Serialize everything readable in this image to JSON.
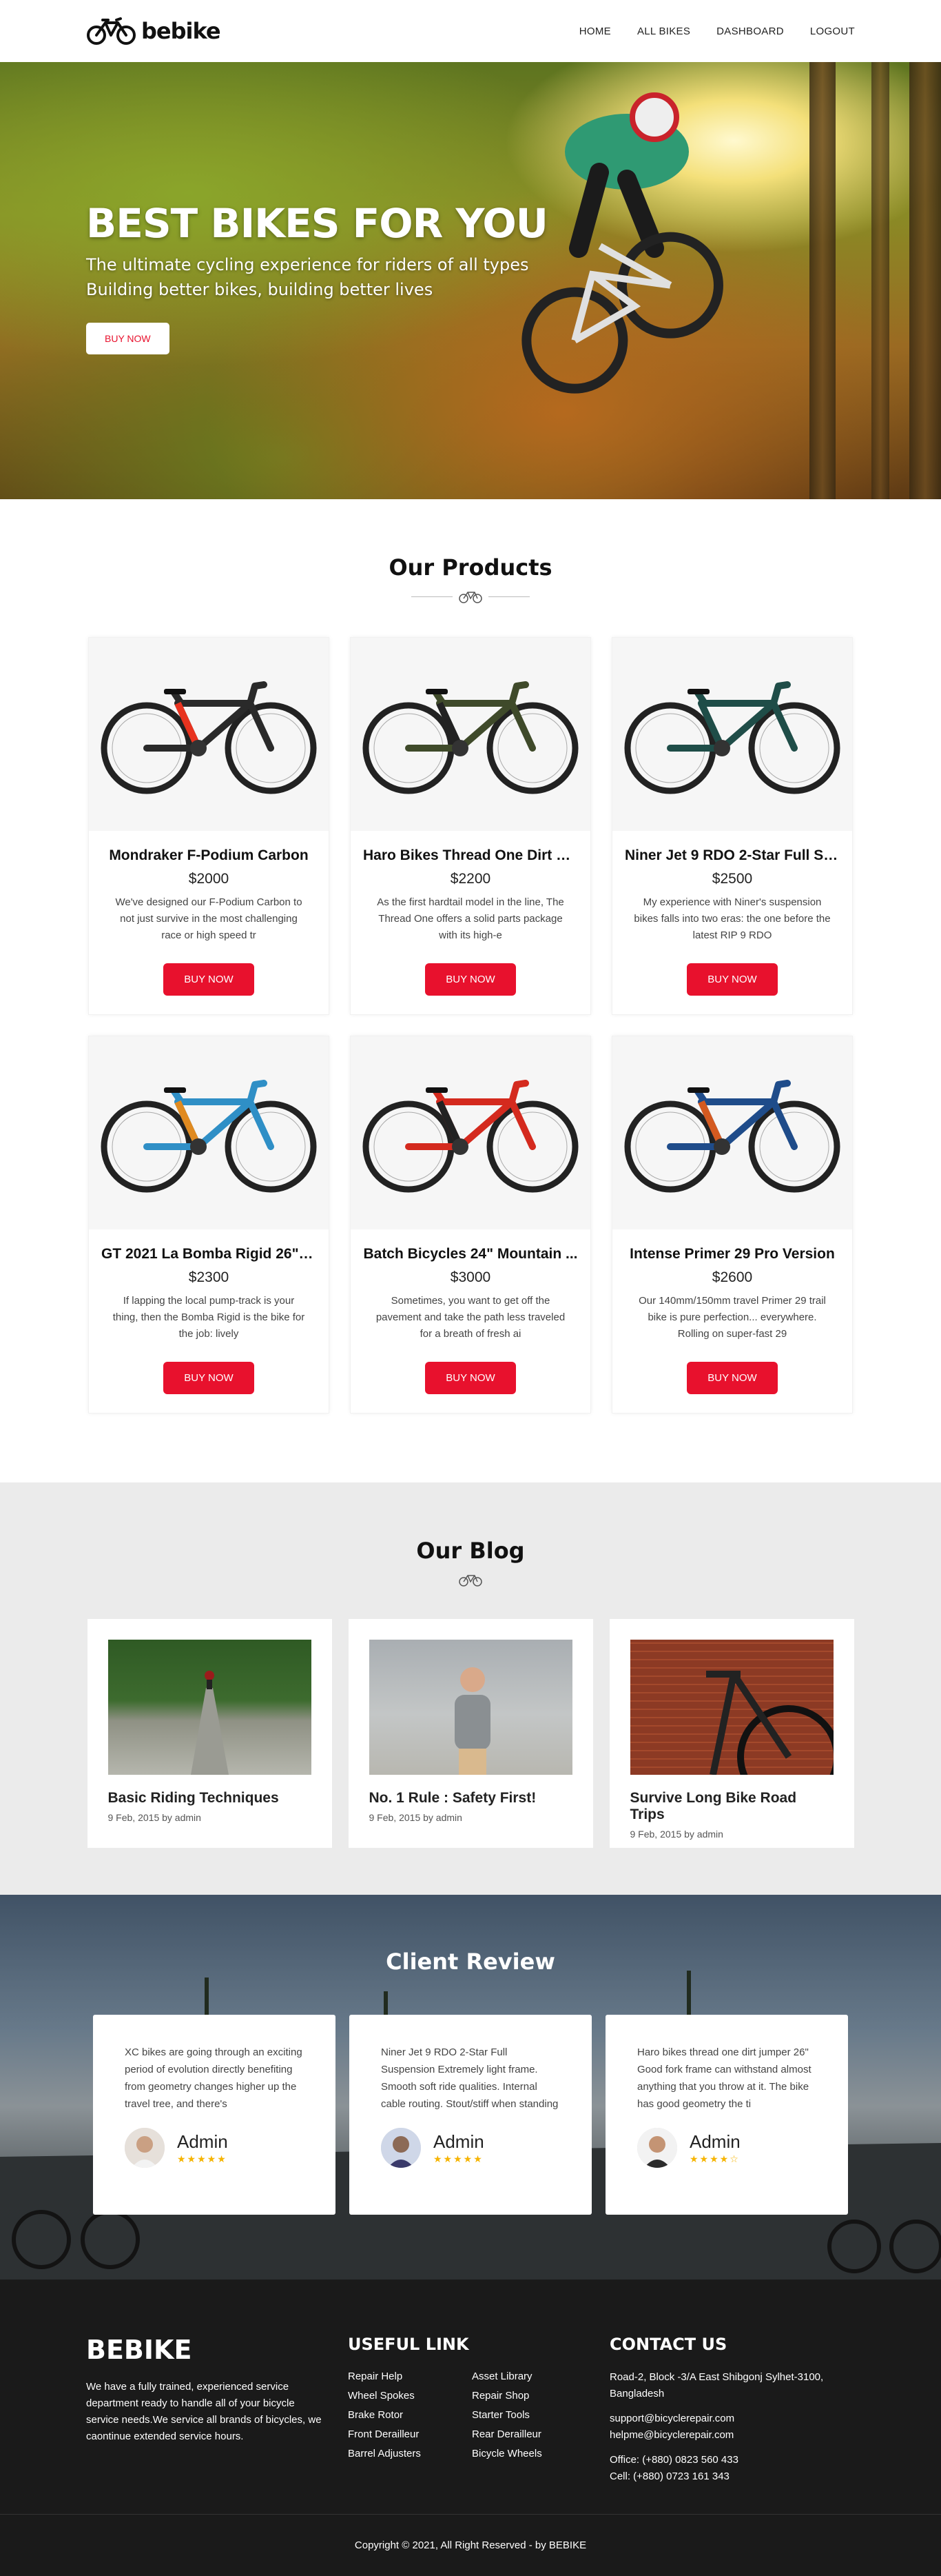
{
  "brand": {
    "name": "bebike"
  },
  "nav": {
    "links": [
      "HOME",
      "ALL BIKES",
      "DASHBOARD",
      "LOGOUT"
    ]
  },
  "hero": {
    "title": "BEST BIKES FOR YOU",
    "subtitle_1": "The ultimate cycling experience for riders of all types",
    "subtitle_2": "Building better bikes, building better lives",
    "button": "BUY NOW"
  },
  "products": {
    "title": "Our Products",
    "items": [
      {
        "name": "Mondraker F-Podium Carbon",
        "price": "$2000",
        "desc": "We've designed our F-Podium Carbon to not just survive in the most challenging race or high speed tr",
        "button": "BUY NOW",
        "frame_color": "#2a2a2a",
        "accent": "#e8331f"
      },
      {
        "name": "Haro Bikes Thread One Dirt Ju...",
        "price": "$2200",
        "desc": "As the first hardtail model in the line, The Thread One offers a solid parts package with its high-e",
        "button": "BUY NOW",
        "frame_color": "#3f4a2a",
        "accent": "#222"
      },
      {
        "name": "Niner Jet 9 RDO 2-Star Full Su...",
        "price": "$2500",
        "desc": "My experience with Niner's suspension bikes falls into two eras: the one before the latest RIP 9 RDO",
        "button": "BUY NOW",
        "frame_color": "#1f4d48",
        "accent": "#1f4d48"
      },
      {
        "name": "GT 2021 La Bomba Rigid 26\" D...",
        "price": "$2300",
        "desc": "If lapping the local pump-track is your thing, then the Bomba Rigid is the bike for the job: lively",
        "button": "BUY NOW",
        "frame_color": "#2f8fc6",
        "accent": "#e08a20"
      },
      {
        "name": "Batch Bicycles 24\" Mountain ...",
        "price": "$3000",
        "desc": "Sometimes, you want to get off the pavement and take the path less traveled for a breath of fresh ai",
        "button": "BUY NOW",
        "frame_color": "#d42a1e",
        "accent": "#222"
      },
      {
        "name": "Intense Primer 29 Pro Version",
        "price": "$2600",
        "desc": "Our 140mm/150mm travel Primer 29 trail bike is pure perfection... everywhere. Rolling on super-fast 29",
        "button": "BUY NOW",
        "frame_color": "#1f4c8a",
        "accent": "#d45a20"
      }
    ]
  },
  "blog": {
    "title": "Our Blog",
    "posts": [
      {
        "title": "Basic Riding Techniques",
        "meta": "9 Feb, 2015 by admin"
      },
      {
        "title": "No. 1 Rule : Safety First!",
        "meta": "9 Feb, 2015 by admin"
      },
      {
        "title": "Survive Long Bike Road Trips",
        "meta": "9 Feb, 2015 by admin"
      }
    ]
  },
  "reviews": {
    "title": "Client Review",
    "items": [
      {
        "text": "XC bikes are going through an exciting period of evolution directly benefiting from geometry changes higher up the travel tree, and there's",
        "name": "Admin",
        "stars": "★★★★★"
      },
      {
        "text": "Niner Jet 9 RDO 2-Star Full Suspension Extremely light frame. Smooth soft ride qualities. Internal cable routing. Stout/stiff when standing",
        "name": "Admin",
        "stars": "★★★★★"
      },
      {
        "text": "Haro bikes thread one dirt jumper 26\" Good fork frame can withstand almost anything that you throw at it. The bike has good geometry the ti",
        "name": "Admin",
        "stars": "★★★★☆"
      }
    ]
  },
  "footer": {
    "brand": "BEBIKE",
    "about": "We have a fully trained, experienced service department ready to handle all of your bicycle service needs.We service all brands of bicycles, we caontinue extended service hours.",
    "useful_title": "USEFUL LINK",
    "links": [
      "Repair Help",
      "Asset Library",
      "Wheel Spokes",
      "Repair Shop",
      "Brake Rotor",
      "Starter Tools",
      "Front Derailleur",
      "Rear Derailleur",
      "Barrel Adjusters",
      "Bicycle Wheels"
    ],
    "contact_title": "CONTACT US",
    "address": "Road-2, Block -3/A East Shibgonj Sylhet-3100, Bangladesh",
    "email_1": "support@bicyclerepair.com",
    "email_2": "helpme@bicyclerepair.com",
    "office": "Office: (+880) 0823 560 433",
    "cell": "Cell: (+880) 0723 161 343",
    "copyright": "Copyright © 2021, All Right Reserved - by BEBIKE"
  }
}
